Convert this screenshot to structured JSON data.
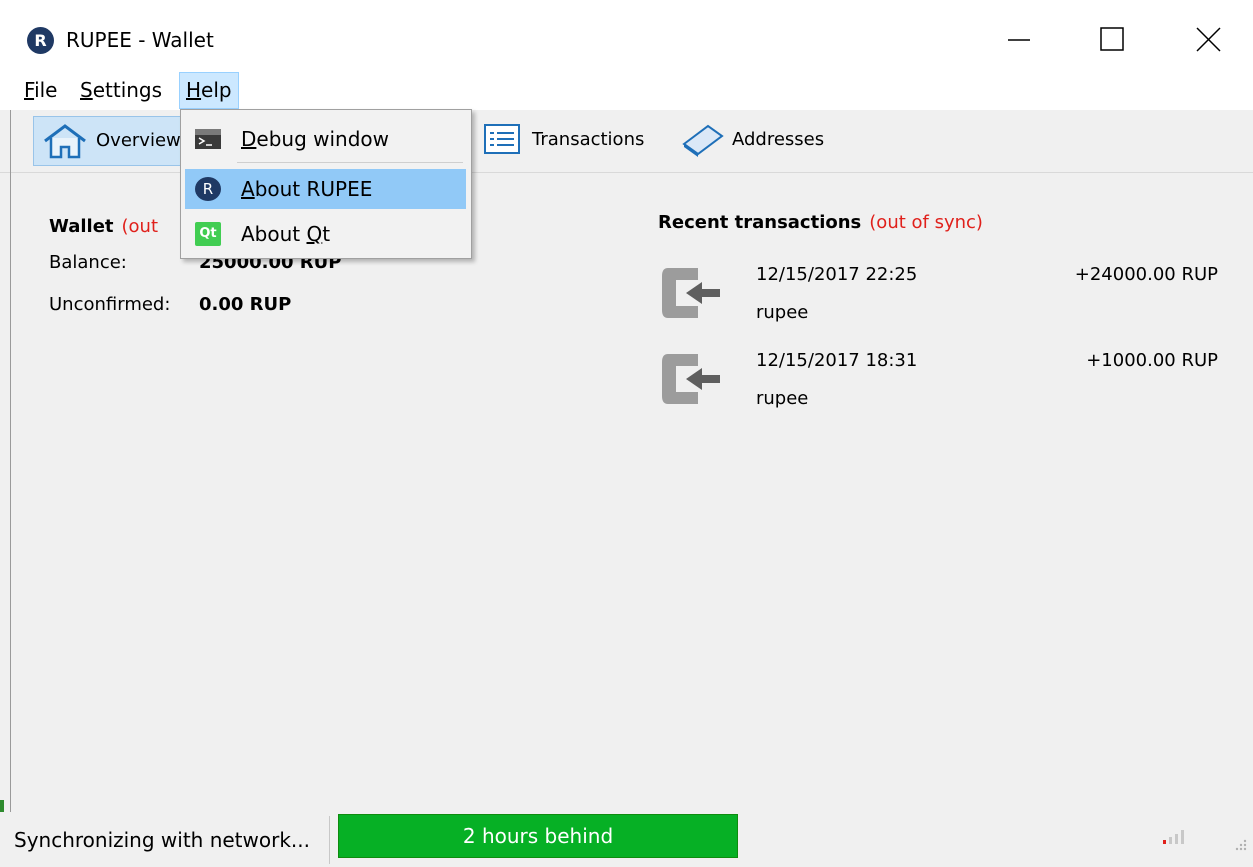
{
  "window": {
    "title": "RUPEE - Wallet",
    "app_icon_letter": "R"
  },
  "menubar": {
    "file": {
      "mnemonic": "F",
      "rest": "ile"
    },
    "settings": {
      "mnemonic": "S",
      "rest": "ettings"
    },
    "help": {
      "mnemonic": "H",
      "rest": "elp"
    }
  },
  "toolbar": {
    "overview": "Overview",
    "transactions": "Transactions",
    "addresses": "Addresses"
  },
  "help_menu": {
    "items": [
      {
        "mnemonic": "D",
        "rest": "ebug window",
        "icon": "terminal-icon"
      },
      {
        "mnemonic": "A",
        "rest": "bout RUPEE",
        "icon": "rupee-logo-icon",
        "highlighted": true
      },
      {
        "prefix": "About ",
        "mnemonic": "Q",
        "rest": "t",
        "icon": "qt-logo-icon"
      }
    ],
    "rupee_letter": "R",
    "qt_text": "Qt"
  },
  "wallet": {
    "heading": "Wallet",
    "status": "(out",
    "balance_label": "Balance:",
    "balance_value": "25000.00 RUP",
    "unconfirmed_label": "Unconfirmed:",
    "unconfirmed_value": "0.00 RUP"
  },
  "recent": {
    "heading": "Recent transactions",
    "status": "(out of sync)",
    "transactions": [
      {
        "date": "12/15/2017 22:25",
        "amount": "+24000.00 RUP",
        "label": "rupee"
      },
      {
        "date": "12/15/2017 18:31",
        "amount": "+1000.00 RUP",
        "label": "rupee"
      }
    ]
  },
  "statusbar": {
    "sync_text": "Synchronizing with network...",
    "progress_text": "2 hours behind",
    "progress": 1.0
  },
  "colors": {
    "out_of_sync": "#e0201b",
    "progress_green": "#06b025",
    "menu_highlight": "#91c9f7"
  }
}
